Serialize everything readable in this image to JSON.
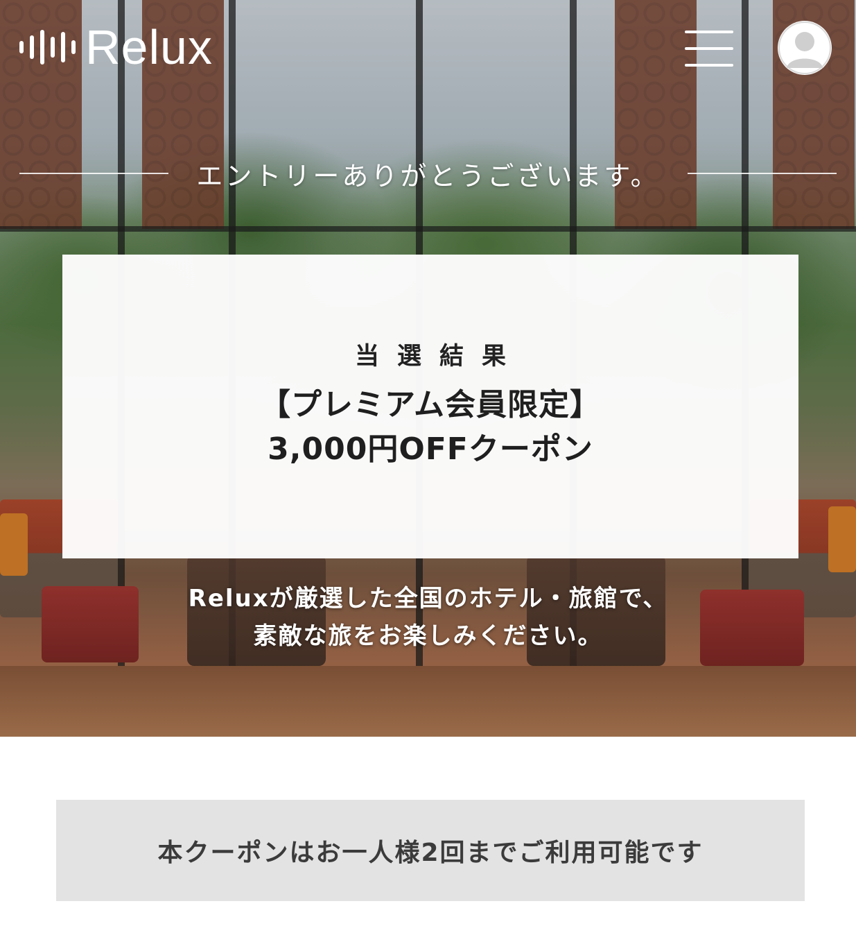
{
  "header": {
    "logo_text": "Relux",
    "menu_icon": "hamburger-icon",
    "avatar_icon": "user-avatar-icon"
  },
  "entry": {
    "thanks_text": "エントリーありがとうございます。"
  },
  "result": {
    "heading": "当選結果",
    "coupon_line1": "【プレミアム会員限定】",
    "coupon_line2": "3,000円OFFクーポン"
  },
  "message": {
    "line1": "Reluxが厳選した全国のホテル・旅館で、",
    "line2": "素敵な旅をお楽しみください。"
  },
  "notice": {
    "text": "本クーポンはお一人様2回までご利用可能です"
  },
  "colors": {
    "card_background": "#ffffff",
    "notice_background": "#e3e3e3",
    "text_dark": "#222222",
    "header_foreground": "#ffffff"
  }
}
